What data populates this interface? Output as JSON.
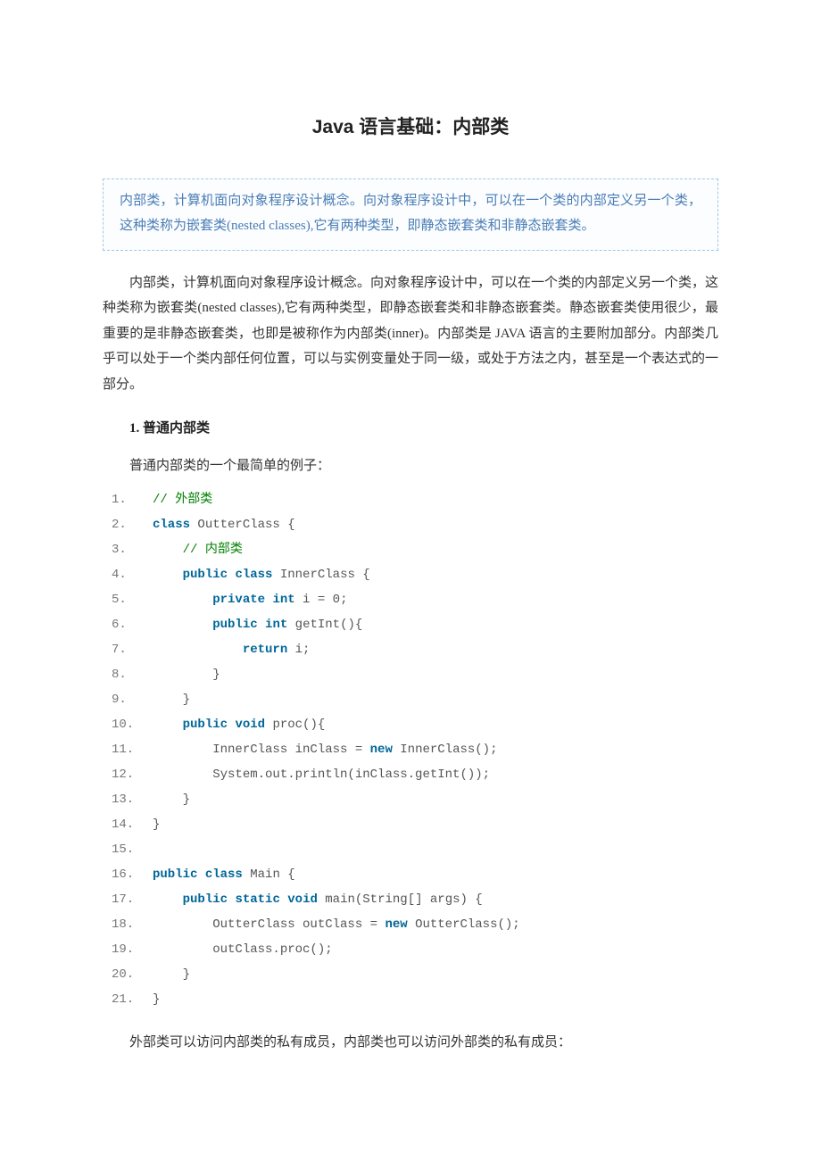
{
  "title": "Java 语言基础：内部类",
  "summary": "内部类，计算机面向对象程序设计概念。向对象程序设计中，可以在一个类的内部定义另一个类，这种类称为嵌套类(nested classes),它有两种类型，即静态嵌套类和非静态嵌套类。",
  "para1": "内部类，计算机面向对象程序设计概念。向对象程序设计中，可以在一个类的内部定义另一个类，这种类称为嵌套类(nested classes),它有两种类型，即静态嵌套类和非静态嵌套类。静态嵌套类使用很少，最重要的是非静态嵌套类，也即是被称作为内部类(inner)。内部类是 JAVA 语言的主要附加部分。内部类几乎可以处于一个类内部任何位置，可以与实例变量处于同一级，或处于方法之内，甚至是一个表达式的一部分。",
  "section1_heading": "1. 普通内部类",
  "section1_intro": "普通内部类的一个最简单的例子：",
  "code1": {
    "lines": [
      {
        "ln": "1.",
        "segs": [
          {
            "t": "comment",
            "v": "// 外部类"
          }
        ]
      },
      {
        "ln": "2.",
        "segs": [
          {
            "t": "kw",
            "v": "class"
          },
          {
            "t": "p",
            "v": " OutterClass {  "
          }
        ]
      },
      {
        "ln": "3.",
        "segs": [
          {
            "t": "p",
            "v": "    "
          },
          {
            "t": "comment",
            "v": "// 内部类"
          }
        ]
      },
      {
        "ln": "4.",
        "segs": [
          {
            "t": "p",
            "v": "    "
          },
          {
            "t": "kw",
            "v": "public"
          },
          {
            "t": "p",
            "v": " "
          },
          {
            "t": "kw",
            "v": "class"
          },
          {
            "t": "p",
            "v": " InnerClass {  "
          }
        ]
      },
      {
        "ln": "5.",
        "segs": [
          {
            "t": "p",
            "v": "        "
          },
          {
            "t": "kw",
            "v": "private"
          },
          {
            "t": "p",
            "v": " "
          },
          {
            "t": "kw",
            "v": "int"
          },
          {
            "t": "p",
            "v": " i = 0;  "
          }
        ]
      },
      {
        "ln": "6.",
        "segs": [
          {
            "t": "p",
            "v": "        "
          },
          {
            "t": "kw",
            "v": "public"
          },
          {
            "t": "p",
            "v": " "
          },
          {
            "t": "kw",
            "v": "int"
          },
          {
            "t": "p",
            "v": " getInt(){  "
          }
        ]
      },
      {
        "ln": "7.",
        "segs": [
          {
            "t": "p",
            "v": "            "
          },
          {
            "t": "kw",
            "v": "return"
          },
          {
            "t": "p",
            "v": " i;  "
          }
        ]
      },
      {
        "ln": "8.",
        "segs": [
          {
            "t": "p",
            "v": "        }  "
          }
        ]
      },
      {
        "ln": "9.",
        "segs": [
          {
            "t": "p",
            "v": "    }  "
          }
        ]
      },
      {
        "ln": "10.",
        "segs": [
          {
            "t": "p",
            "v": "    "
          },
          {
            "t": "kw",
            "v": "public"
          },
          {
            "t": "p",
            "v": " "
          },
          {
            "t": "kw",
            "v": "void"
          },
          {
            "t": "p",
            "v": " proc(){  "
          }
        ]
      },
      {
        "ln": "11.",
        "segs": [
          {
            "t": "p",
            "v": "        InnerClass inClass = "
          },
          {
            "t": "kw",
            "v": "new"
          },
          {
            "t": "p",
            "v": " InnerClass();  "
          }
        ]
      },
      {
        "ln": "12.",
        "segs": [
          {
            "t": "p",
            "v": "        System.out.println(inClass.getInt());  "
          }
        ]
      },
      {
        "ln": "13.",
        "segs": [
          {
            "t": "p",
            "v": "    }  "
          }
        ]
      },
      {
        "ln": "14.",
        "segs": [
          {
            "t": "p",
            "v": "}  "
          }
        ]
      },
      {
        "ln": "15.",
        "segs": [
          {
            "t": "p",
            "v": "  "
          }
        ]
      },
      {
        "ln": "16.",
        "segs": [
          {
            "t": "kw",
            "v": "public"
          },
          {
            "t": "p",
            "v": " "
          },
          {
            "t": "kw",
            "v": "class"
          },
          {
            "t": "p",
            "v": " Main {  "
          }
        ]
      },
      {
        "ln": "17.",
        "segs": [
          {
            "t": "p",
            "v": "    "
          },
          {
            "t": "kw",
            "v": "public"
          },
          {
            "t": "p",
            "v": " "
          },
          {
            "t": "kw",
            "v": "static"
          },
          {
            "t": "p",
            "v": " "
          },
          {
            "t": "kw",
            "v": "void"
          },
          {
            "t": "p",
            "v": " main(String[] args) {  "
          }
        ]
      },
      {
        "ln": "18.",
        "segs": [
          {
            "t": "p",
            "v": "        OutterClass outClass = "
          },
          {
            "t": "kw",
            "v": "new"
          },
          {
            "t": "p",
            "v": " OutterClass();  "
          }
        ]
      },
      {
        "ln": "19.",
        "segs": [
          {
            "t": "p",
            "v": "        outClass.proc();  "
          }
        ]
      },
      {
        "ln": "20.",
        "segs": [
          {
            "t": "p",
            "v": "    }  "
          }
        ]
      },
      {
        "ln": "21.",
        "segs": [
          {
            "t": "p",
            "v": "}  "
          }
        ]
      }
    ]
  },
  "para2": "外部类可以访问内部类的私有成员，内部类也可以访问外部类的私有成员："
}
